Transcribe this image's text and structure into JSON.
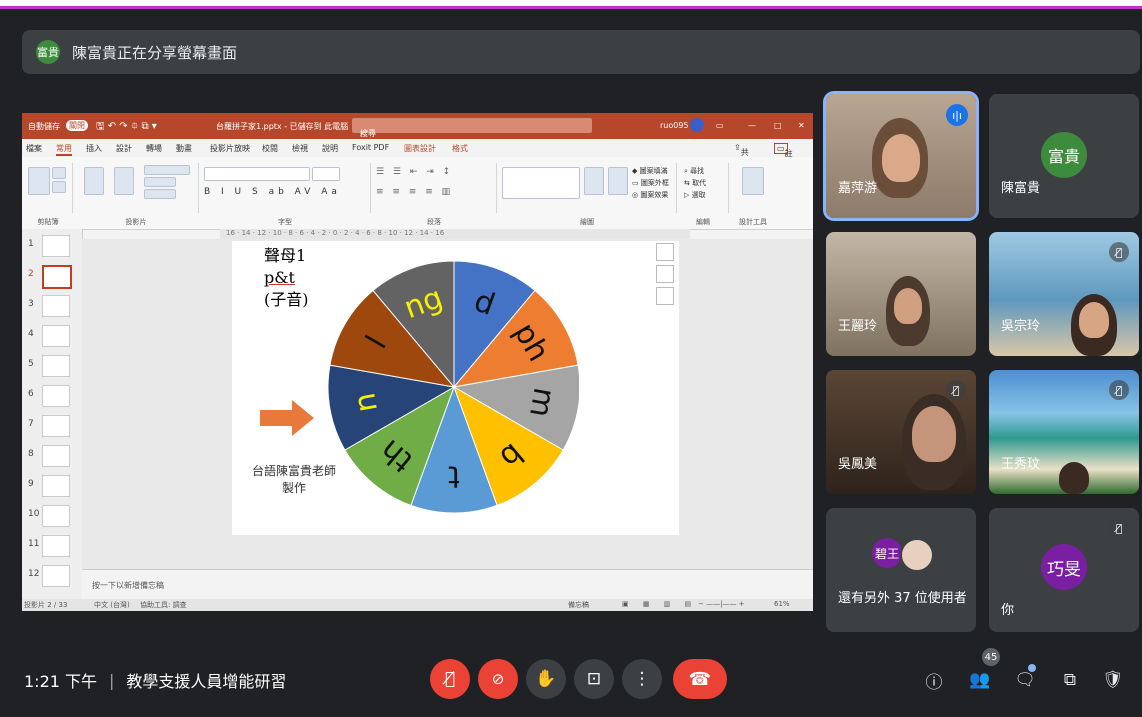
{
  "share_banner": {
    "avatar": "富貴",
    "text": "陳富貴正在分享螢幕畫面"
  },
  "powerpoint": {
    "autosave": "自動儲存",
    "autosave_state": "關閉",
    "filename": "台羅拼子家1.pptx - 已儲存到 此電腦",
    "search": "搜尋",
    "user": "ruo095",
    "menu": [
      "檔案",
      "常用",
      "插入",
      "設計",
      "轉場",
      "動畫",
      "投影片放映",
      "校閱",
      "檢視",
      "說明",
      "Foxit PDF",
      "圖表設計",
      "格式"
    ],
    "share": "共用",
    "comment": "註解",
    "groups": [
      "剪貼簿",
      "投影片",
      "字型",
      "段落",
      "繪圖",
      "編輯",
      "設計工具"
    ],
    "ruler": "16 · 14 · 12 · 10 · 8 · 6 · 4 · 2 · 0 · 2 · 4 · 6 · 8 · 10 · 12 · 14 · 16",
    "thumbs": [
      "1",
      "2",
      "3",
      "4",
      "5",
      "6",
      "7",
      "8",
      "9",
      "10",
      "11",
      "12"
    ],
    "slide_title": [
      "聲母1",
      "p&t",
      "(子音)"
    ],
    "credit": [
      "台語陳富貴老師",
      "製作"
    ],
    "wheel": [
      "d",
      "ph",
      "m",
      "b",
      "t",
      "th",
      "n",
      "l",
      "ng"
    ],
    "notes": "按一下以新增備忘稿",
    "status_left": "投影片 2 / 33",
    "status_lang": "中文 (台灣)",
    "status_access": "協助工具: 調查",
    "status_notes": "備忘稿",
    "zoom": "61%"
  },
  "participants": [
    {
      "name": "嘉萍游",
      "speaking": true
    },
    {
      "name": "陳富貴",
      "initials": "富貴",
      "color": "#3d8b3d"
    },
    {
      "name": "王麗玲"
    },
    {
      "name": "吳宗玲",
      "muted": true
    },
    {
      "name": "吳鳳美",
      "muted": true
    },
    {
      "name": "王秀玟",
      "muted": true
    },
    {
      "name": "還有另外 37 位使用者",
      "initials": "碧王"
    },
    {
      "name": "你",
      "initials": "巧旻",
      "muted": true,
      "color": "#7b1fa2"
    }
  ],
  "bottom": {
    "time": "1:21 下午",
    "separator": "|",
    "meeting": "教學支援人員增能研習",
    "participant_count": "45"
  },
  "colors": {
    "accent": "#8ab4f8",
    "red": "#ea4335",
    "ppt": "#b7472a"
  }
}
